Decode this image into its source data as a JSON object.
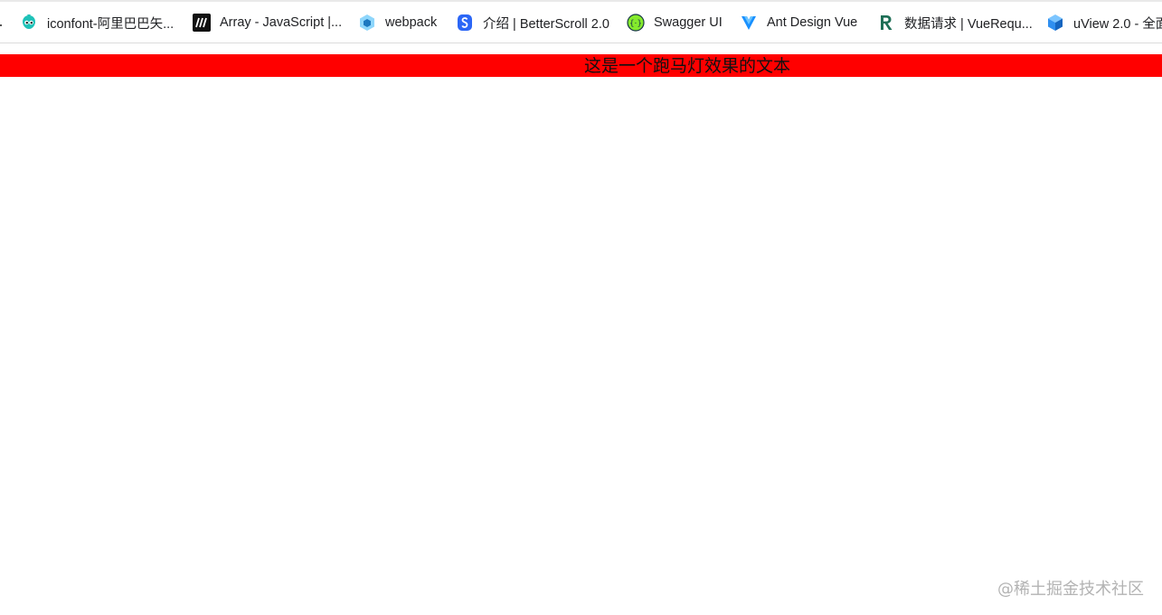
{
  "bookmarks": [
    {
      "label": "iconfont-阿里巴巴矢...",
      "icon": "iconfont-icon"
    },
    {
      "label": "Array - JavaScript |...",
      "icon": "mdn-icon"
    },
    {
      "label": "webpack",
      "icon": "webpack-icon"
    },
    {
      "label": "介绍 | BetterScroll 2.0",
      "icon": "betterscroll-icon"
    },
    {
      "label": "Swagger UI",
      "icon": "swagger-icon"
    },
    {
      "label": "Ant Design Vue",
      "icon": "antdv-icon"
    },
    {
      "label": "数据请求 | VueRequ...",
      "icon": "vuerequest-icon"
    },
    {
      "label": "uView 2.0 - 全面",
      "icon": "uview-icon"
    }
  ],
  "marquee": {
    "text": "这是一个跑马灯效果的文本",
    "background": "#ff0000"
  },
  "watermark": {
    "text": "@稀土掘金技术社区"
  },
  "colors": {
    "marquee_bg": "#ff0000",
    "page_bg": "#ffffff"
  }
}
